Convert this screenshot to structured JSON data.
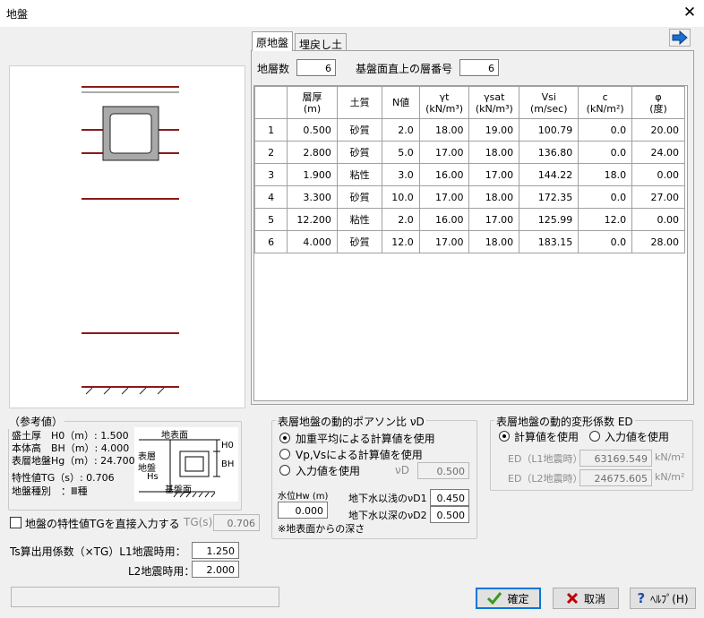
{
  "window": {
    "title": "地盤",
    "close_glyph": "✕"
  },
  "tabs": [
    {
      "label": "原地盤",
      "active": true
    },
    {
      "label": "埋戻し土",
      "active": false
    }
  ],
  "layer_count": {
    "label": "地層数",
    "value": "6"
  },
  "base_layer": {
    "label": "基盤面直上の層番号",
    "value": "6"
  },
  "table": {
    "headers": [
      {
        "line1": "",
        "line2": ""
      },
      {
        "line1": "層厚",
        "line2": "(m)"
      },
      {
        "line1": "土質",
        "line2": ""
      },
      {
        "line1": "N値",
        "line2": ""
      },
      {
        "line1": "γt",
        "line2": "(kN/m³)"
      },
      {
        "line1": "γsat",
        "line2": "(kN/m³)"
      },
      {
        "line1": "Vsi",
        "line2": "(m/sec)"
      },
      {
        "line1": "c",
        "line2": "(kN/m²)"
      },
      {
        "line1": "φ",
        "line2": "(度)"
      }
    ],
    "rows": [
      [
        "1",
        "0.500",
        "砂質",
        "2.0",
        "18.00",
        "19.00",
        "100.79",
        "0.0",
        "20.00"
      ],
      [
        "2",
        "2.800",
        "砂質",
        "5.0",
        "17.00",
        "18.00",
        "136.80",
        "0.0",
        "24.00"
      ],
      [
        "3",
        "1.900",
        "粘性",
        "3.0",
        "16.00",
        "17.00",
        "144.22",
        "18.0",
        "0.00"
      ],
      [
        "4",
        "3.300",
        "砂質",
        "10.0",
        "17.00",
        "18.00",
        "172.35",
        "0.0",
        "27.00"
      ],
      [
        "5",
        "12.200",
        "粘性",
        "2.0",
        "16.00",
        "17.00",
        "125.99",
        "12.0",
        "0.00"
      ],
      [
        "6",
        "4.000",
        "砂質",
        "12.0",
        "17.00",
        "18.00",
        "183.15",
        "0.0",
        "28.00"
      ]
    ]
  },
  "reference": {
    "title": "（参考値）",
    "h0": "盛土厚　H0（m）: 1.500",
    "bh": "本体高　BH（m）: 4.000",
    "hg": "表層地盤Hg（m）: 24.700",
    "tg": "特性値TG（s）: 0.706",
    "kind": "地盤種別　：Ⅲ種"
  },
  "diagram": {
    "ground_surface": "地表面",
    "surface_layer": [
      "表層",
      "地盤"
    ],
    "hs": "Hs",
    "base_surface": "基盤面",
    "h0": "H0",
    "bh": "BH"
  },
  "poisson": {
    "title": "表層地盤の動的ポアソン比 νD",
    "options": [
      "加重平均による計算値を使用",
      "Vp,Vsによる計算値を使用",
      "入力値を使用"
    ],
    "selected_index": 0,
    "nu_label": "νD",
    "nu_value": "0.500",
    "water_label": "水位Hw (m)",
    "water_value": "0.000",
    "shallow_label": "地下水以浅のνD1",
    "shallow_value": "0.450",
    "deep_label": "地下水以深のνD2",
    "deep_value": "0.500",
    "note": "※地表面からの深さ"
  },
  "deform": {
    "title": "表層地盤の動的変形係数 ED",
    "options": [
      "計算値を使用",
      "入力値を使用"
    ],
    "selected_index": 0,
    "l1_label": "ED（L1地震時）",
    "l1_value": "63169.549",
    "l2_label": "ED（L2地震時）",
    "l2_value": "24675.605",
    "unit": "kN/m²"
  },
  "direct_tg": {
    "label": "地盤の特性値TGを直接入力する",
    "checked": false,
    "tg_label": "TG(s)",
    "tg_value": "0.706"
  },
  "ts": {
    "label": "Ts算出用係数（×TG）L1地震時用：",
    "l1_value": "1.250",
    "l2_label": "L2地震時用：",
    "l2_value": "2.000"
  },
  "buttons": {
    "ok": "確定",
    "cancel": "取消",
    "help": "ﾍﾙﾌﾟ(H)"
  },
  "colors": {
    "layer_line": "#8b1a1a",
    "box_fill": "#a9a9a9",
    "ok_icon": "#3a9a1a",
    "cancel_icon": "#c00000",
    "help_icon": "#1a4fb0",
    "arrow_icon": "#1c6fd1"
  }
}
